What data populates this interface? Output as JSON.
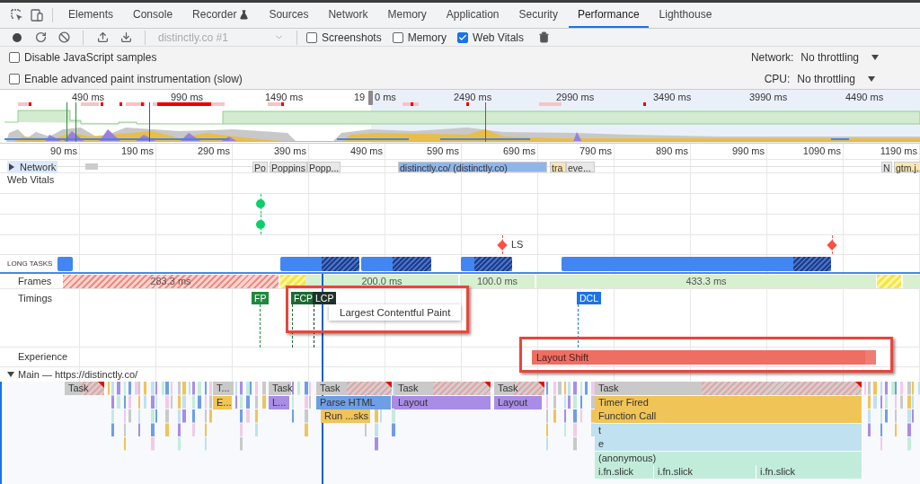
{
  "devtools_tabs": [
    {
      "label": "Elements",
      "selected": false
    },
    {
      "label": "Console",
      "selected": false
    },
    {
      "label": "Recorder",
      "selected": false
    },
    {
      "label": "Sources",
      "selected": false
    },
    {
      "label": "Network",
      "selected": false
    },
    {
      "label": "Memory",
      "selected": false
    },
    {
      "label": "Application",
      "selected": false
    },
    {
      "label": "Security",
      "selected": false
    },
    {
      "label": "Performance",
      "selected": true
    },
    {
      "label": "Lighthouse",
      "selected": false
    }
  ],
  "toolbar": {
    "recording": "distinctly.co #1",
    "checkboxes": [
      {
        "label": "Screenshots",
        "checked": false
      },
      {
        "label": "Memory",
        "checked": false
      },
      {
        "label": "Web Vitals",
        "checked": true
      }
    ]
  },
  "settings": {
    "checkboxes": [
      {
        "label": "Disable JavaScript samples",
        "checked": false
      },
      {
        "label": "Enable advanced paint instrumentation (slow)",
        "checked": false
      }
    ],
    "network": {
      "label": "Network:",
      "value": "No throttling"
    },
    "cpu": {
      "label": "CPU:",
      "value": "No throttling"
    }
  },
  "overview": {
    "ticks": [
      "490 ms",
      "990 ms",
      "1490 ms",
      "19",
      "0 ms",
      "2490 ms",
      "2990 ms",
      "3490 ms",
      "3990 ms",
      "4490 ms"
    ]
  },
  "ruler": {
    "ticks": [
      "90 ms",
      "190 ms",
      "290 ms",
      "390 ms",
      "490 ms",
      "590 ms",
      "690 ms",
      "790 ms",
      "890 ms",
      "990 ms",
      "1090 ms",
      "1190 ms"
    ]
  },
  "network_track": {
    "label": "Network",
    "requests": [
      {
        "text": "Po",
        "kind": "font"
      },
      {
        "text": "Poppins",
        "kind": "font"
      },
      {
        "text": "Popp...",
        "kind": "font"
      },
      {
        "text": "distinctly.co/ (distinctly.co)",
        "kind": "document"
      },
      {
        "text": "tra",
        "kind": "script"
      },
      {
        "text": "eve...",
        "kind": "font"
      },
      {
        "text": "N",
        "kind": "font"
      },
      {
        "text": "gtm.j..",
        "kind": "script"
      }
    ]
  },
  "web_vitals": {
    "label": "Web Vitals",
    "lanes": [
      {
        "markers": [
          {
            "color": "#0cce6b"
          }
        ]
      },
      {
        "markers": [
          {
            "color": "#0cce6b"
          }
        ]
      },
      {
        "markers": [
          {
            "color": "#ff4e42",
            "text": "LS"
          },
          {
            "color": "#ff4e42"
          }
        ]
      }
    ]
  },
  "long_tasks": {
    "label": "LONG TASKS"
  },
  "frames": {
    "label": "Frames",
    "segments": [
      {
        "text": "283.3 ms",
        "kind": "dropped"
      },
      {
        "kind": "partial"
      },
      {
        "text": "200.0 ms",
        "kind": "good"
      },
      {
        "text": "100.0 ms",
        "kind": "good"
      },
      {
        "text": "433.3 ms",
        "kind": "good"
      },
      {
        "kind": "partial"
      },
      {
        "kind": "good"
      }
    ]
  },
  "timings": {
    "label": "Timings",
    "markers": [
      {
        "text": "FP",
        "kind": "fp"
      },
      {
        "text": "FCP",
        "kind": "fcp"
      },
      {
        "text": "LCP",
        "kind": "lcp"
      },
      {
        "text": "DCL",
        "kind": "dcl"
      }
    ],
    "tooltip": "Largest Contentful Paint"
  },
  "experience": {
    "label": "Experience",
    "events": [
      "Layout Shift"
    ]
  },
  "main": {
    "label": "Main — https://distinctly.co/",
    "tasks": [
      {
        "text": "Task",
        "kind": "task",
        "long": true
      },
      {
        "text": "T...",
        "kind": "task",
        "long": false,
        "children": [
          {
            "text": "E...",
            "kind": "script"
          }
        ]
      },
      {
        "text": "Task",
        "kind": "task",
        "long": false,
        "children": [
          {
            "text": "L...",
            "kind": "layout"
          }
        ]
      },
      {
        "text": "Task",
        "kind": "task",
        "long": true,
        "children": [
          {
            "text": "Parse HTML",
            "kind": "parse",
            "children": [
              {
                "text": "Run ...sks",
                "kind": "script"
              }
            ]
          }
        ]
      },
      {
        "text": "Task",
        "kind": "task",
        "long": true,
        "children": [
          {
            "text": "Layout",
            "kind": "layout"
          }
        ]
      },
      {
        "text": "Task",
        "kind": "task",
        "long": true,
        "children": [
          {
            "text": "Layout",
            "kind": "layout"
          }
        ]
      },
      {
        "text": "Task",
        "kind": "task",
        "long": true,
        "children": [
          {
            "text": "Timer Fired",
            "kind": "script",
            "children": [
              {
                "text": "Function Call",
                "kind": "script",
                "children": [
                  {
                    "text": "t",
                    "kind": "js",
                    "children": [
                      {
                        "text": "e",
                        "kind": "js",
                        "children": [
                          {
                            "text": "(anonymous)",
                            "kind": "anon",
                            "children": [
                              {
                                "text": "i.fn.slick",
                                "kind": "anon"
                              },
                              {
                                "text": "i.fn.slick",
                                "kind": "anon"
                              },
                              {
                                "text": "i.fn.slick",
                                "kind": "anon"
                              }
                            ]
                          }
                        ]
                      }
                    ]
                  }
                ]
              }
            ]
          }
        ]
      }
    ]
  }
}
